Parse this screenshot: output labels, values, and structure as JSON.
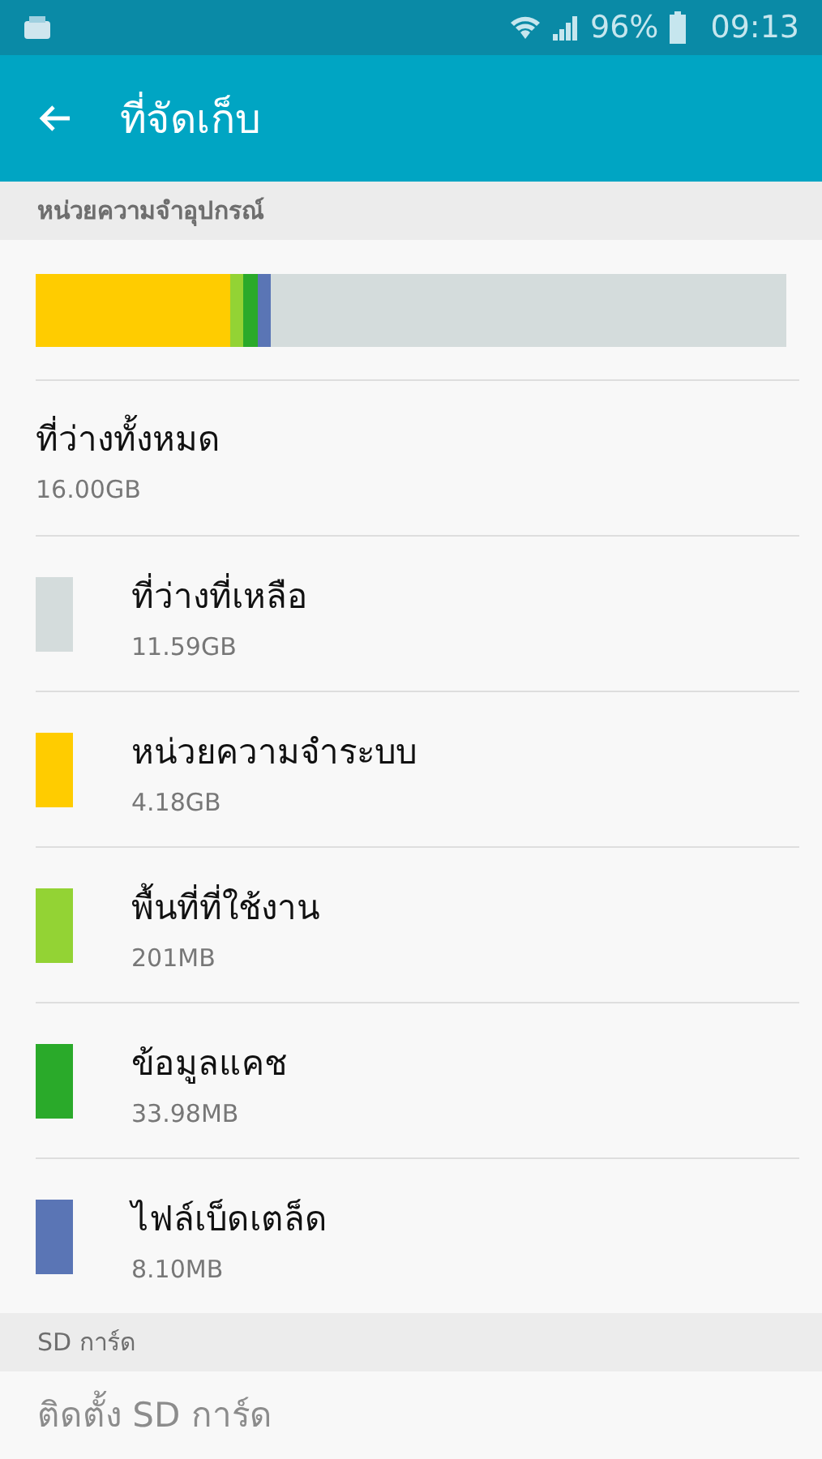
{
  "status_bar": {
    "battery": "96%",
    "time": "09:13"
  },
  "app_bar": {
    "title": "ที่จัดเก็บ"
  },
  "device_section": {
    "header": "หน่วยความจำอุปกรณ์",
    "usage_bar": {
      "segments": [
        {
          "color": "#ffcc00"
        },
        {
          "color": "#93d334"
        },
        {
          "color": "#2aaa2a"
        },
        {
          "color": "#5a75b5"
        }
      ]
    },
    "total": {
      "label": "ที่ว่างทั้งหมด",
      "value": "16.00GB"
    },
    "items": [
      {
        "label": "ที่ว่างที่เหลือ",
        "value": "11.59GB",
        "color": "#d4dcdc"
      },
      {
        "label": "หน่วยความจำระบบ",
        "value": "4.18GB",
        "color": "#ffcc00"
      },
      {
        "label": "พื้นที่ที่ใช้งาน",
        "value": "201MB",
        "color": "#93d334"
      },
      {
        "label": "ข้อมูลแคช",
        "value": "33.98MB",
        "color": "#2aaa2a"
      },
      {
        "label": "ไฟล์เบ็ดเตล็ด",
        "value": "8.10MB",
        "color": "#5a75b5"
      }
    ]
  },
  "sd_section": {
    "header": "SD การ์ด",
    "items": [
      {
        "label": "ติดตั้ง SD การ์ด",
        "disabled": true
      }
    ]
  }
}
